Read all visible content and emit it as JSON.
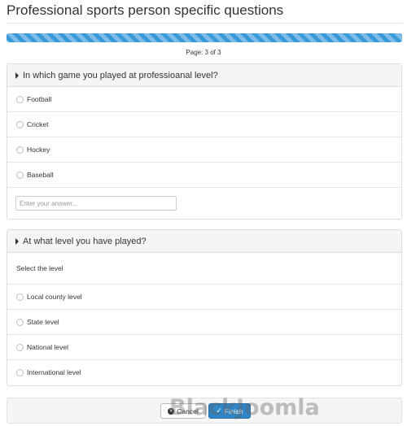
{
  "page": {
    "title": "Professional sports person specific questions",
    "progress_percent": 100,
    "page_counter": "Page: 3 of 3"
  },
  "question1": {
    "heading": "In which game you played at professioanal level?",
    "options": [
      "Football",
      "Cricket",
      "Hockey",
      "Baseball"
    ],
    "other_input": {
      "value": "",
      "placeholder": "Enter your answer..."
    }
  },
  "question2": {
    "heading": "At what level you have played?",
    "select_label": "Select the level",
    "options": [
      "Local county level",
      "State level",
      "National level",
      "International level"
    ]
  },
  "footer": {
    "cancel_label": "Cancel",
    "finish_label": "Finish"
  },
  "watermark": "BlackJoomla",
  "colors": {
    "progress": "#3a99d8",
    "finish_button": "#2f86c8",
    "panel_heading_bg": "#f5f5f5"
  },
  "icons": {
    "heading_caret": "caret-right-icon",
    "cancel": "circle-x-icon",
    "finish": "check-icon"
  }
}
